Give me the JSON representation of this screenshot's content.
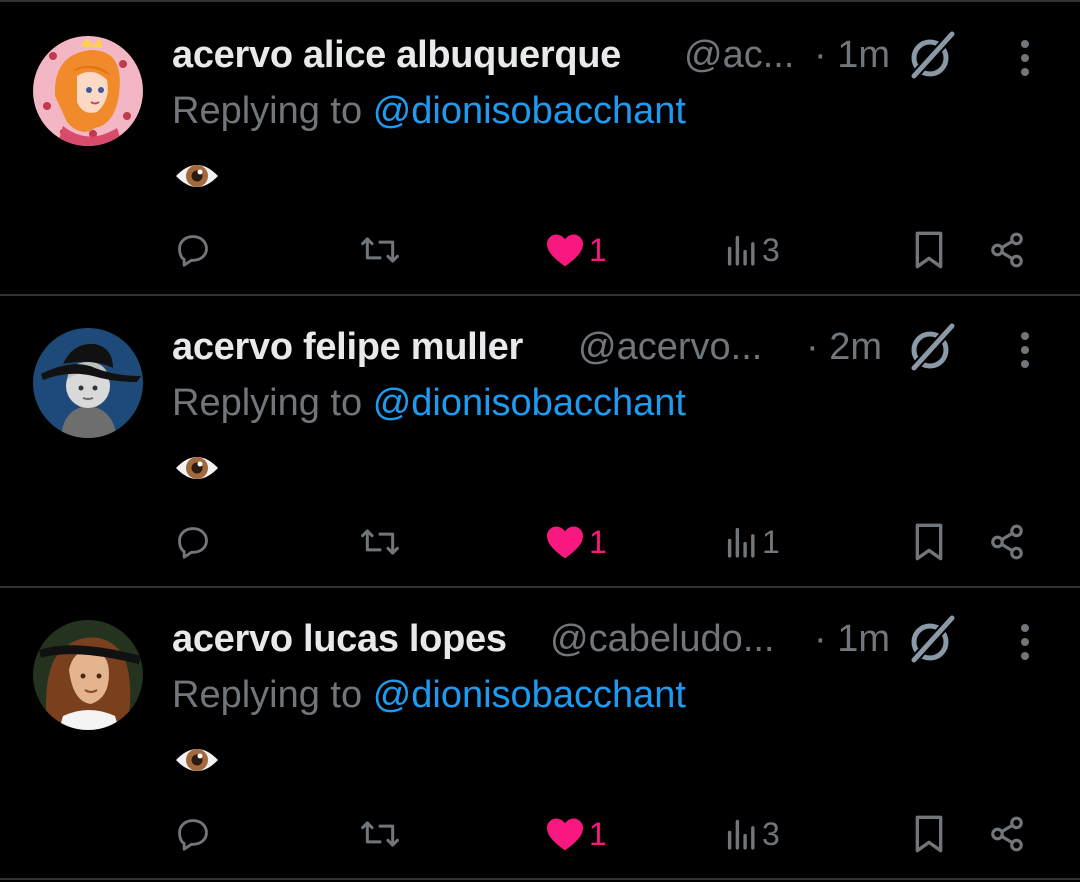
{
  "colors": {
    "background": "#000000",
    "primary_text": "#e7e9ea",
    "secondary_text": "#71767b",
    "mention": "#1d9bf0",
    "like": "#f91880",
    "divider": "#2f3336"
  },
  "tweets": [
    {
      "display_name": "acervo alice albuquerque",
      "handle": "@ac...",
      "time": "· 1m",
      "reply_prefix": "Replying to",
      "reply_to": "@dionisobacchant",
      "body_icon": "eye-emoji",
      "likes": "1",
      "views": "3",
      "liked": true
    },
    {
      "display_name": "acervo felipe muller",
      "handle": "@acervo...",
      "time": "· 2m",
      "reply_prefix": "Replying to",
      "reply_to": "@dionisobacchant",
      "body_icon": "eye-emoji",
      "likes": "1",
      "views": "1",
      "liked": true
    },
    {
      "display_name": "acervo lucas lopes",
      "handle": "@cabeludo...",
      "time": "· 1m",
      "reply_prefix": "Replying to",
      "reply_to": "@dionisobacchant",
      "body_icon": "eye-emoji",
      "likes": "1",
      "views": "3",
      "liked": true
    }
  ]
}
